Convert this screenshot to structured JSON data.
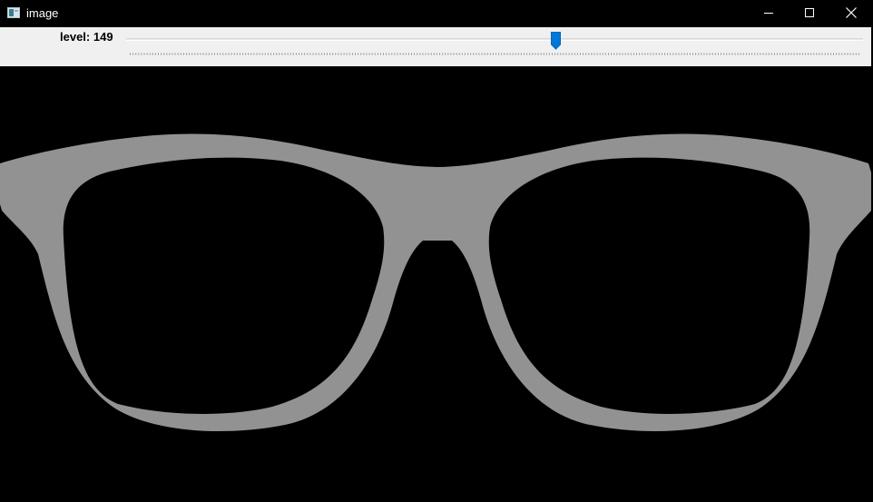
{
  "window": {
    "title": "image",
    "icon": "app-window-icon",
    "controls": [
      "minimize-icon",
      "maximize-icon",
      "close-icon"
    ]
  },
  "trackbar": {
    "label": "level: 149",
    "value": 149,
    "min": 0,
    "max": 255,
    "accent_color": "#0078d7"
  },
  "image": {
    "description_colors": {
      "background": "#000000",
      "shape": "#929292"
    }
  }
}
